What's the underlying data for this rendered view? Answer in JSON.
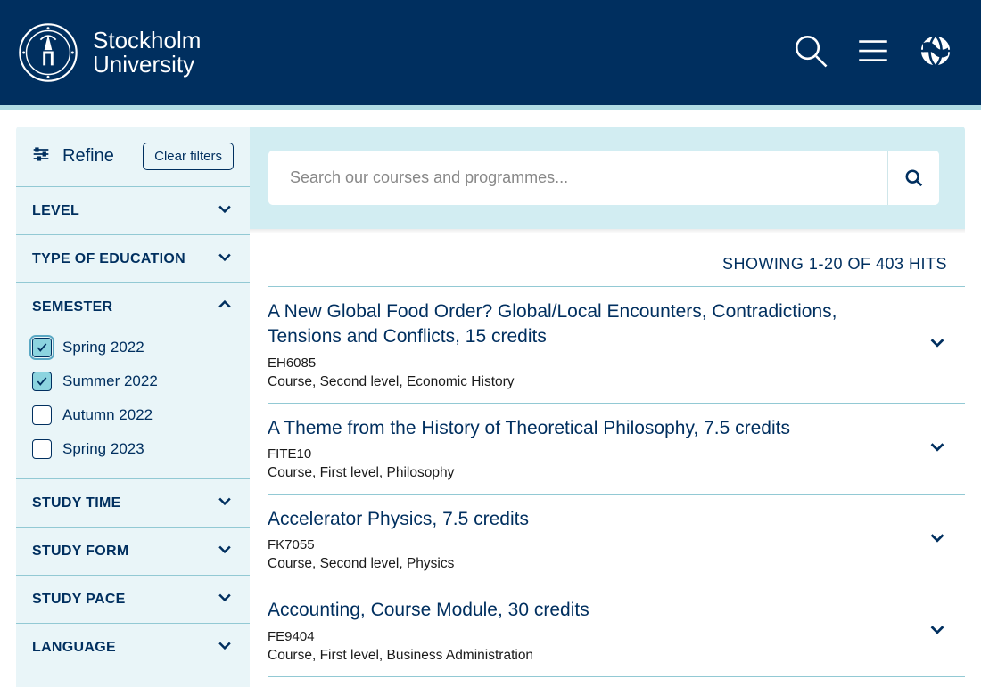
{
  "header": {
    "brand_line1": "Stockholm",
    "brand_line2": "University"
  },
  "sidebar": {
    "refine_label": "Refine",
    "clear_label": "Clear filters",
    "filters": [
      {
        "title": "LEVEL",
        "expanded": false,
        "options": []
      },
      {
        "title": "TYPE OF EDUCATION",
        "expanded": false,
        "options": []
      },
      {
        "title": "SEMESTER",
        "expanded": true,
        "options": [
          {
            "label": "Spring 2022",
            "checked": true,
            "focused": true
          },
          {
            "label": "Summer 2022",
            "checked": true,
            "focused": false
          },
          {
            "label": "Autumn 2022",
            "checked": false,
            "focused": false
          },
          {
            "label": "Spring 2023",
            "checked": false,
            "focused": false
          }
        ]
      },
      {
        "title": "STUDY TIME",
        "expanded": false,
        "options": []
      },
      {
        "title": "STUDY FORM",
        "expanded": false,
        "options": []
      },
      {
        "title": "STUDY PACE",
        "expanded": false,
        "options": []
      },
      {
        "title": "LANGUAGE",
        "expanded": false,
        "options": []
      }
    ]
  },
  "search": {
    "placeholder": "Search our courses and programmes..."
  },
  "results": {
    "meta": "SHOWING 1-20 OF 403 HITS",
    "items": [
      {
        "title": "A New Global Food Order? Global/Local Encounters, Contradictions, Tensions and Conflicts, 15 credits",
        "code": "EH6085",
        "meta": "Course, Second level, Economic History"
      },
      {
        "title": "A Theme from the History of Theoretical Philosophy, 7.5 credits",
        "code": "FITE10",
        "meta": "Course, First level, Philosophy"
      },
      {
        "title": "Accelerator Physics, 7.5 credits",
        "code": "FK7055",
        "meta": "Course, Second level, Physics"
      },
      {
        "title": "Accounting, Course Module, 30 credits",
        "code": "FE9404",
        "meta": "Course, First level, Business Administration"
      }
    ]
  }
}
